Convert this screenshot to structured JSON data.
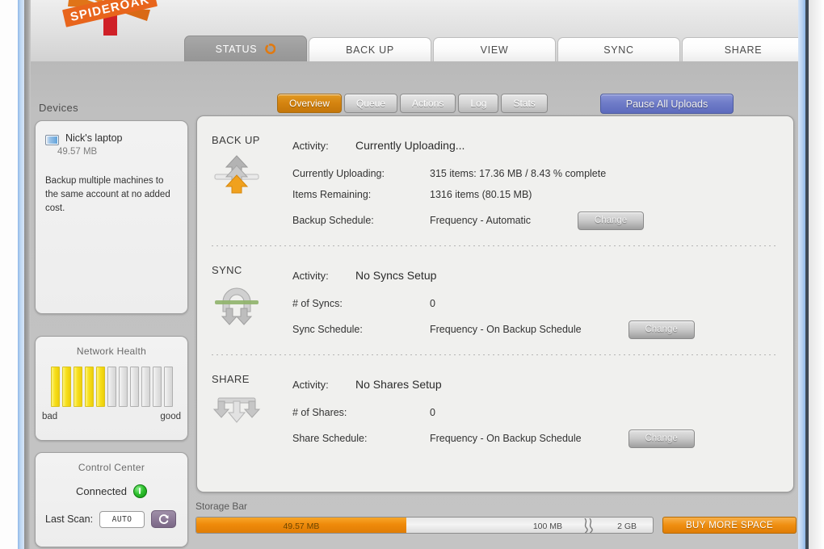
{
  "app": {
    "name": "SpiderOak",
    "logo_text": "SPIDEROAK"
  },
  "tabs": [
    {
      "label": "STATUS",
      "icon": "spinner-icon",
      "active": true
    },
    {
      "label": "BACK UP",
      "active": false
    },
    {
      "label": "VIEW",
      "active": false
    },
    {
      "label": "SYNC",
      "active": false
    },
    {
      "label": "SHARE",
      "active": false
    }
  ],
  "subnav": {
    "pills": [
      {
        "label": "Overview",
        "active": true
      },
      {
        "label": "Queue",
        "active": false
      },
      {
        "label": "Actions",
        "active": false
      },
      {
        "label": "Log",
        "active": false
      },
      {
        "label": "Stats",
        "active": false
      }
    ],
    "pause_button": "Pause All Uploads"
  },
  "sidebar": {
    "devices_title": "Devices",
    "device": {
      "name": "Nick's laptop",
      "size": "49.57 MB",
      "note": "Backup multiple machines to the same account at no added cost."
    },
    "network_health": {
      "title": "Network Health",
      "bars_total": 11,
      "bars_filled": 5,
      "low_label": "bad",
      "high_label": "good"
    },
    "control_center": {
      "title": "Control Center",
      "status": "Connected",
      "scan_label": "Last Scan:",
      "scan_value": "AUTO"
    }
  },
  "main": {
    "sections": [
      {
        "title": "BACK UP",
        "icon": "upload-arrows-icon",
        "activity_label": "Activity:",
        "activity_value": "Currently Uploading...",
        "rows": [
          {
            "label": "Currently Uploading:",
            "value": "315 items: 17.36 MB / 8.43 % complete"
          },
          {
            "label": "Items Remaining:",
            "value": "1316 items (80.15 MB)"
          },
          {
            "label": "Backup Schedule:",
            "value": "Frequency - Automatic",
            "button": "Change"
          }
        ]
      },
      {
        "title": "SYNC",
        "icon": "sync-arch-icon",
        "activity_label": "Activity:",
        "activity_value": "No Syncs Setup",
        "rows": [
          {
            "label": "# of Syncs:",
            "value": "0"
          },
          {
            "label": "Sync Schedule:",
            "value": "Frequency - On Backup Schedule",
            "button": "Change"
          }
        ]
      },
      {
        "title": "SHARE",
        "icon": "share-arrows-icon",
        "activity_label": "Activity:",
        "activity_value": "No Shares Setup",
        "rows": [
          {
            "label": "# of Shares:",
            "value": "0"
          },
          {
            "label": "Share Schedule:",
            "value": "Frequency - On Backup Schedule",
            "button": "Change"
          }
        ]
      }
    ]
  },
  "storage": {
    "label": "Storage Bar",
    "used": "49.57 MB",
    "mark_mid": "100 MB",
    "mark_max": "2 GB",
    "fill_percent": 46,
    "buy_button": "BUY MORE SPACE"
  },
  "colors": {
    "accent_orange": "#d4830f",
    "pause_blue": "#6f7cc8",
    "health_yellow": "#f7e01b",
    "connected_green": "#2fc02f",
    "storage_orange": "#ef8a0a"
  }
}
